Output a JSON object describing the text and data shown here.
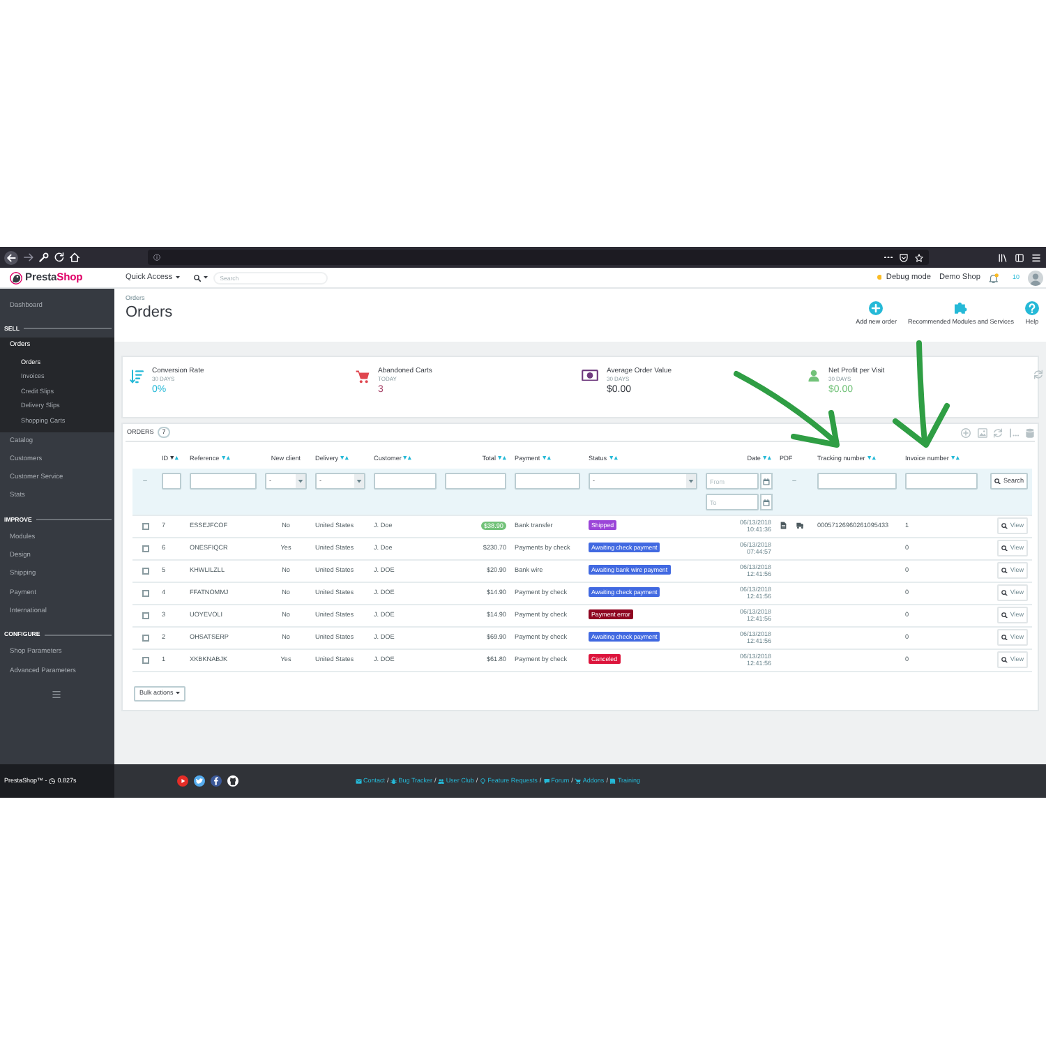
{
  "header": {
    "logo": [
      "Presta",
      "Shop"
    ],
    "quick_access": "Quick Access",
    "search": {
      "placeholder": "Search"
    },
    "debug_mode": "Debug mode",
    "shop": "Demo Shop",
    "count": "10"
  },
  "sidebar": [
    {
      "kind": "link",
      "label": "Dashboard",
      "selected": false
    },
    {
      "kind": "section",
      "label": "SELL"
    },
    {
      "kind": "link",
      "label": "Orders",
      "selected": true,
      "expanded": true,
      "children": [
        {
          "label": "Orders",
          "selected": true
        },
        {
          "label": "Invoices",
          "selected": false
        },
        {
          "label": "Credit Slips",
          "selected": false
        },
        {
          "label": "Delivery Slips",
          "selected": false
        },
        {
          "label": "Shopping Carts",
          "selected": false
        }
      ]
    },
    {
      "kind": "link",
      "label": "Catalog",
      "selected": false
    },
    {
      "kind": "link",
      "label": "Customers",
      "selected": false
    },
    {
      "kind": "link",
      "label": "Customer Service",
      "selected": false
    },
    {
      "kind": "link",
      "label": "Stats",
      "selected": false
    },
    {
      "kind": "section",
      "label": "IMPROVE"
    },
    {
      "kind": "link",
      "label": "Modules",
      "selected": false
    },
    {
      "kind": "link",
      "label": "Design",
      "selected": false
    },
    {
      "kind": "link",
      "label": "Shipping",
      "selected": false
    },
    {
      "kind": "link",
      "label": "Payment",
      "selected": false
    },
    {
      "kind": "link",
      "label": "International",
      "selected": false
    },
    {
      "kind": "section",
      "label": "CONFIGURE"
    },
    {
      "kind": "link",
      "label": "Shop Parameters",
      "selected": false
    },
    {
      "kind": "link",
      "label": "Advanced Parameters",
      "selected": false
    }
  ],
  "page": {
    "breadcrumb": "Orders",
    "title": "Orders",
    "toolbar": [
      {
        "kind": "add",
        "label": "Add new order"
      },
      {
        "kind": "modules",
        "label": "Recommended Modules and Services"
      },
      {
        "kind": "help",
        "label": "Help"
      }
    ]
  },
  "kpis": [
    {
      "kind": "conversion",
      "title": "Conversion Rate",
      "period": "30 DAYS",
      "color": "#25b9d7",
      "value": {
        "text": "0%",
        "color": "#25b9d7"
      }
    },
    {
      "kind": "carts",
      "title": "Abandoned Carts",
      "period": "TODAY",
      "color": "#e0464f",
      "value": {
        "text": "3",
        "color": "#a8476b"
      }
    },
    {
      "kind": "order_value",
      "title": "Average Order Value",
      "period": "30 DAYS",
      "color": "#6f3a7e",
      "value": {
        "text": "$0.00",
        "color": "#363a41"
      }
    },
    {
      "kind": "profit",
      "title": "Net Profit per Visit",
      "period": "30 DAYS",
      "color": "#72c279",
      "value": {
        "text": "$0.00",
        "color": "#72c279"
      }
    }
  ],
  "orders": {
    "title": "ORDERS",
    "count": "7",
    "columns": [
      {
        "kind": "check"
      },
      {
        "kind": "text",
        "label": "ID",
        "sortable": true,
        "sorted": true
      },
      {
        "kind": "text",
        "label": "Reference",
        "sortable": true,
        "sorted": false
      },
      {
        "kind": "text",
        "label": "New client",
        "sortable": false
      },
      {
        "kind": "text",
        "label": "Delivery",
        "sortable": true,
        "sorted": false
      },
      {
        "kind": "text",
        "label": "Customer",
        "sortable": true,
        "sorted": false
      },
      {
        "kind": "money",
        "label": "Total",
        "sortable": true,
        "sorted": false
      },
      {
        "kind": "text",
        "label": "Payment",
        "sortable": true,
        "sorted": false
      },
      {
        "kind": "text",
        "label": "Status",
        "sortable": true,
        "sorted": false
      },
      {
        "kind": "date",
        "label": "Date",
        "sortable": true,
        "sorted": false
      },
      {
        "kind": "text",
        "label": "PDF",
        "sortable": false
      },
      {
        "kind": "text",
        "label": "Tracking number",
        "sortable": true,
        "sorted": false
      },
      {
        "kind": "text",
        "label": "Invoice number",
        "sortable": true,
        "sorted": false
      },
      {
        "kind": "actions"
      }
    ],
    "filters": [
      {
        "kind": "dash",
        "text": "–"
      },
      {
        "kind": "input"
      },
      {
        "kind": "input"
      },
      {
        "kind": "select",
        "value": "-"
      },
      {
        "kind": "select",
        "value": "-"
      },
      {
        "kind": "input"
      },
      {
        "kind": "input"
      },
      {
        "kind": "input"
      },
      {
        "kind": "select",
        "value": "-"
      },
      {
        "kind": "date_range",
        "from": {
          "placeholder": "From"
        },
        "to": {
          "placeholder": "To"
        }
      },
      {
        "kind": "dash",
        "text": "–"
      },
      {
        "kind": "input"
      },
      {
        "kind": "input"
      },
      {
        "kind": "button",
        "label": "Search"
      }
    ],
    "rows": [
      {
        "checked": false,
        "id": "7",
        "reference": "ESSEJFCOF",
        "new_client": "No",
        "delivery": "United States",
        "customer": "J. Doe",
        "total": "$38.90",
        "total_highlight": true,
        "payment": "Bank transfer",
        "status": {
          "label": "Shipped",
          "color": "#9b45d8"
        },
        "date": "06/13/2018",
        "time": "10:41:36",
        "pdf": [
          {
            "kind": "invoice"
          },
          {
            "kind": "delivery"
          }
        ],
        "tracking_number": "00057126960261095433",
        "invoice_number": "1",
        "action": "View"
      },
      {
        "checked": false,
        "id": "6",
        "reference": "ONESFIQCR",
        "new_client": "Yes",
        "delivery": "United States",
        "customer": "J. Doe",
        "total": "$230.70",
        "total_highlight": false,
        "payment": "Payments by check",
        "status": {
          "label": "Awaiting check payment",
          "color": "#4169e1"
        },
        "date": "06/13/2018",
        "time": "07:44:57",
        "invoice_number": "0",
        "action": "View"
      },
      {
        "checked": false,
        "id": "5",
        "reference": "KHWLILZLL",
        "new_client": "No",
        "delivery": "United States",
        "customer": "J. DOE",
        "total": "$20.90",
        "total_highlight": false,
        "payment": "Bank wire",
        "status": {
          "label": "Awaiting bank wire payment",
          "color": "#4169e1"
        },
        "date": "06/13/2018",
        "time": "12:41:56",
        "invoice_number": "0",
        "action": "View"
      },
      {
        "checked": false,
        "id": "4",
        "reference": "FFATNOMMJ",
        "new_client": "No",
        "delivery": "United States",
        "customer": "J. DOE",
        "total": "$14.90",
        "total_highlight": false,
        "payment": "Payment by check",
        "status": {
          "label": "Awaiting check payment",
          "color": "#4169e1"
        },
        "date": "06/13/2018",
        "time": "12:41:56",
        "invoice_number": "0",
        "action": "View"
      },
      {
        "checked": false,
        "id": "3",
        "reference": "UOYEVOLI",
        "new_client": "No",
        "delivery": "United States",
        "customer": "J. DOE",
        "total": "$14.90",
        "total_highlight": false,
        "payment": "Payment by check",
        "status": {
          "label": "Payment error",
          "color": "#8f0621"
        },
        "date": "06/13/2018",
        "time": "12:41:56",
        "invoice_number": "0",
        "action": "View"
      },
      {
        "checked": false,
        "id": "2",
        "reference": "OHSATSERP",
        "new_client": "No",
        "delivery": "United States",
        "customer": "J. DOE",
        "total": "$69.90",
        "total_highlight": false,
        "payment": "Payment by check",
        "status": {
          "label": "Awaiting check payment",
          "color": "#4169e1"
        },
        "date": "06/13/2018",
        "time": "12:41:56",
        "invoice_number": "0",
        "action": "View"
      },
      {
        "checked": false,
        "id": "1",
        "reference": "XKBKNABJK",
        "new_client": "Yes",
        "delivery": "United States",
        "customer": "J. DOE",
        "total": "$61.80",
        "total_highlight": false,
        "payment": "Payment by check",
        "status": {
          "label": "Canceled",
          "color": "#dc143c"
        },
        "date": "06/13/2018",
        "time": "12:41:56",
        "invoice_number": "0",
        "action": "View"
      }
    ],
    "bulk_actions": "Bulk actions"
  },
  "footer": {
    "version": "PrestaShop™ -",
    "time": "0.827s",
    "links": [
      {
        "kind": "mail",
        "label": "Contact",
        "separator": "/"
      },
      {
        "kind": "bug",
        "label": "Bug Tracker",
        "separator": "/"
      },
      {
        "kind": "users",
        "label": "User Club",
        "separator": "/"
      },
      {
        "kind": "idea",
        "label": "Feature Requests",
        "separator": "/"
      },
      {
        "kind": "chat",
        "label": "Forum",
        "separator": "/"
      },
      {
        "kind": "cart",
        "label": "Addons",
        "separator": "/"
      },
      {
        "kind": "book",
        "label": "Training"
      }
    ]
  }
}
